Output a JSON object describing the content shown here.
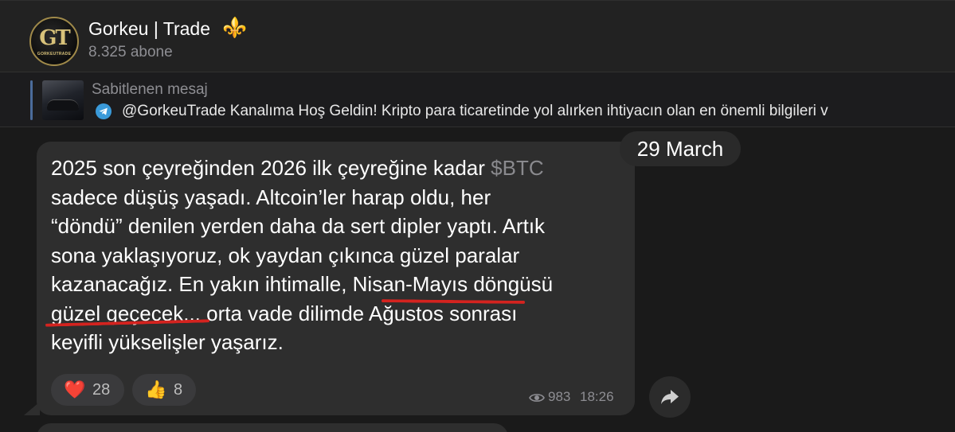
{
  "channel": {
    "title": "Gorkeu | Trade",
    "title_emoji": "⚜️",
    "subscribers": "8.325 abone",
    "avatar_mark": "GT",
    "avatar_text": "GORKEUTRADE"
  },
  "pinned": {
    "label": "Sabitlenen mesaj",
    "icon": "telegram-icon",
    "text": "@GorkeuTrade Kanalıma Hoş Geldin!   Kripto para ticaretinde yol alırken ihtiyacın olan en önemli bilgileri v"
  },
  "date_pill": "29 March",
  "message": {
    "lines": [
      "2025 son çeyreğinden 2026 ilk çeyreğine kadar ",
      "sadece düşüş yaşadı. Altcoin’ler harap oldu, her",
      "“döndü” denilen yerden daha da sert dipler yaptı. Artık",
      "sona yaklaşıyoruz, ok yaydan çıkınca güzel paralar",
      "kazanacağız. En yakın ihtimalle, Nisan-Mayıs döngüsü",
      "güzel geçecek... orta vade dilimde Ağustos sonrası",
      "keyifli yükselişler yaşarız."
    ],
    "cashtag": "$BTC",
    "underline_color": "#d4231f",
    "reactions": [
      {
        "emoji": "❤️",
        "count": "28",
        "icon": "heart-icon"
      },
      {
        "emoji": "👍",
        "count": "8",
        "icon": "thumbs-up-icon"
      }
    ],
    "views": "983",
    "time": "18:26"
  },
  "colors": {
    "background": "#1a1a1a",
    "bubble": "#2e2e2e",
    "muted": "#8e8e93",
    "accent": "#5f8fd0"
  }
}
